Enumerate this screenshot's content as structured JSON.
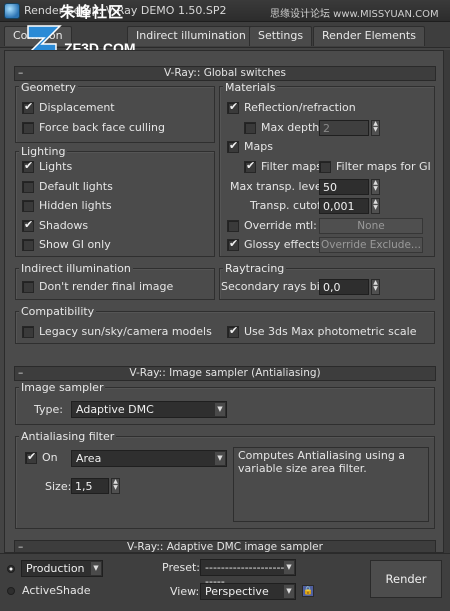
{
  "window": {
    "title": "Render Setup: V-Ray DEMO 1.50.SP2",
    "watermark_cn": "朱峰社区",
    "watermark_url": "ZF3D.COM",
    "watermark_right": "思缘设计论坛  www.MISSYUAN.COM"
  },
  "tabs": [
    {
      "label": "Common",
      "active": true
    },
    {
      "label": "Indirect illumination",
      "active": false
    },
    {
      "label": "Settings",
      "active": false
    },
    {
      "label": "Render Elements",
      "active": false
    }
  ],
  "global_switches": {
    "header": "V-Ray:: Global switches",
    "geometry": {
      "title": "Geometry",
      "displacement": {
        "label": "Displacement",
        "checked": true
      },
      "force_back_face_culling": {
        "label": "Force back face culling",
        "checked": false
      }
    },
    "lighting": {
      "title": "Lighting",
      "lights": {
        "label": "Lights",
        "checked": true
      },
      "default_lights": {
        "label": "Default lights",
        "checked": false
      },
      "hidden_lights": {
        "label": "Hidden lights",
        "checked": false
      },
      "shadows": {
        "label": "Shadows",
        "checked": true
      },
      "show_gi_only": {
        "label": "Show GI only",
        "checked": false
      }
    },
    "materials": {
      "title": "Materials",
      "reflection_refraction": {
        "label": "Reflection/refraction",
        "checked": true
      },
      "max_depth": {
        "label": "Max depth",
        "checked": false,
        "value": "2"
      },
      "maps": {
        "label": "Maps",
        "checked": true
      },
      "filter_maps": {
        "label": "Filter maps",
        "checked": true
      },
      "filter_maps_gi": {
        "label": "Filter maps for GI",
        "checked": false
      },
      "max_transp_levels": {
        "label": "Max transp. levels",
        "value": "50"
      },
      "transp_cutoff": {
        "label": "Transp. cutoff",
        "value": "0,001"
      },
      "override_mtl": {
        "label": "Override mtl:",
        "checked": false,
        "button": "None"
      },
      "glossy_effects": {
        "label": "Glossy effects",
        "checked": true,
        "button": "Override Exclude..."
      }
    },
    "indirect_illumination": {
      "title": "Indirect illumination",
      "dont_render_final_image": {
        "label": "Don't render final image",
        "checked": false
      }
    },
    "raytracing": {
      "title": "Raytracing",
      "secondary_rays_bias": {
        "label": "Secondary rays bias",
        "value": "0,0"
      }
    },
    "compatibility": {
      "title": "Compatibility",
      "legacy_models": {
        "label": "Legacy sun/sky/camera models",
        "checked": false
      },
      "photometric_scale": {
        "label": "Use 3ds Max photometric scale",
        "checked": true
      }
    }
  },
  "image_sampler": {
    "header": "V-Ray:: Image sampler (Antialiasing)",
    "group_title": "Image sampler",
    "type_label": "Type:",
    "type_value": "Adaptive DMC"
  },
  "antialiasing_filter": {
    "title": "Antialiasing filter",
    "on": {
      "label": "On",
      "checked": true
    },
    "filter_value": "Area",
    "description": "Computes Antialiasing using a variable size area filter.",
    "size_label": "Size:",
    "size_value": "1,5"
  },
  "adaptive_dmc": {
    "header": "V-Ray:: Adaptive DMC image sampler"
  },
  "bottom": {
    "production": {
      "label": "Production",
      "selected": true
    },
    "activeshade": {
      "label": "ActiveShade",
      "selected": false
    },
    "preset_label": "Preset:",
    "preset_value": "--------------------------",
    "view_label": "View:",
    "view_value": "Perspective",
    "render_button": "Render",
    "lock_icon": "lock-icon"
  },
  "colors": {
    "panel_bg": "#4b4b4b",
    "field_bg": "#2e2e2e",
    "text": "#e6e6e6"
  }
}
